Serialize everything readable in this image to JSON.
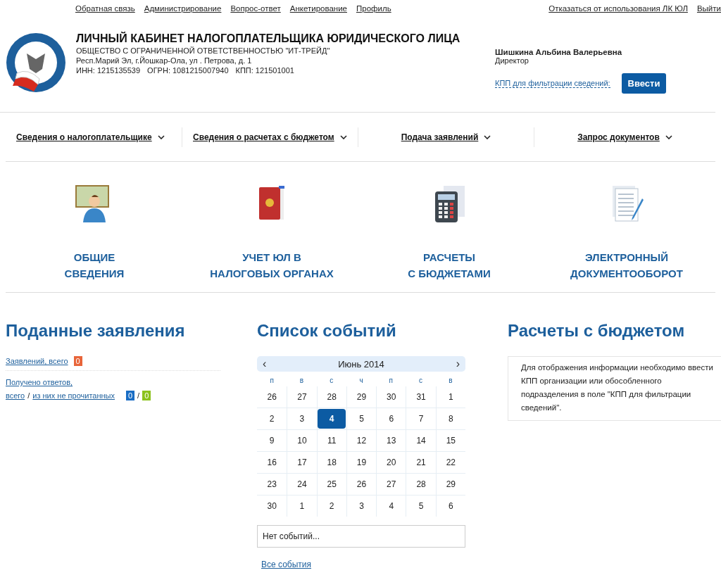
{
  "top_links": [
    "Обратная связь",
    "Администрирование",
    "Вопрос-ответ",
    "Анкетирование",
    "Профиль"
  ],
  "top_right_links": [
    "Отказаться от использования ЛК ЮЛ",
    "Выйти"
  ],
  "header": {
    "title": "ЛИЧНЫЙ КАБИНЕТ НАЛОГОПЛАТЕЛЬЩИКА ЮРИДИЧЕСКОГО ЛИЦА",
    "company": "ОБЩЕСТВО С ОГРАНИЧЕННОЙ ОТВЕТСТВЕННОСТЬЮ \"ИТ-ТРЕЙД\"",
    "address": "Респ.Марий Эл, г.Йошкар-Ола, ул . Петрова, д. 1",
    "ids": [
      "ИНН: 1215135539",
      "ОГРН: 1081215007940",
      "КПП: 121501001"
    ]
  },
  "user": {
    "name": "Шишкина Альбина Валерьевна",
    "role": "Директор",
    "kpp_link": "КПП для фильтрации сведений:",
    "kpp_button": "Ввести"
  },
  "nav": [
    "Сведения о налогоплательщике",
    "Сведения о расчетах с бюджетом",
    "Подача заявлений",
    "Запрос документов"
  ],
  "sections": [
    {
      "kind": "person",
      "title": [
        "ОБЩИЕ",
        "СВЕДЕНИЯ"
      ]
    },
    {
      "kind": "book",
      "title": [
        "УЧЕТ ЮЛ В",
        "НАЛОГОВЫХ ОРГАНАХ"
      ]
    },
    {
      "kind": "calculator",
      "title": [
        "РАСЧЕТЫ",
        "С БЮДЖЕТАМИ"
      ]
    },
    {
      "kind": "document",
      "title": [
        "ЭЛЕКТРОННЫЙ",
        "ДОКУМЕНТООБОРОТ"
      ]
    }
  ],
  "applications": {
    "title": "Поданные заявления",
    "total_label": "Заявлений, всего",
    "total_count": {
      "text": "0",
      "color": "#e8653a"
    },
    "answers_label": "Получено ответов,",
    "answers_total": "всего",
    "answers_unread": "из них не прочитанных",
    "slash": "/",
    "answer_counts": [
      {
        "text": "0",
        "color": "#1a6dc4"
      },
      {
        "text": "0",
        "color": "#8cc21e"
      }
    ]
  },
  "events": {
    "title": "Список событий",
    "month": "Июнь 2014",
    "prev": "‹",
    "next": "›",
    "weekdays": [
      "п",
      "в",
      "с",
      "ч",
      "п",
      "с",
      "в"
    ],
    "weeks": [
      [
        {
          "label": "26",
          "selected": false
        },
        {
          "label": "27",
          "selected": false
        },
        {
          "label": "28",
          "selected": false
        },
        {
          "label": "29",
          "selected": false
        },
        {
          "label": "30",
          "selected": false
        },
        {
          "label": "31",
          "selected": false
        },
        {
          "label": "1",
          "selected": false
        }
      ],
      [
        {
          "label": "2",
          "selected": false
        },
        {
          "label": "3",
          "selected": false
        },
        {
          "label": "4",
          "selected": true
        },
        {
          "label": "5",
          "selected": false
        },
        {
          "label": "6",
          "selected": false
        },
        {
          "label": "7",
          "selected": false
        },
        {
          "label": "8",
          "selected": false
        }
      ],
      [
        {
          "label": "9",
          "selected": false
        },
        {
          "label": "10",
          "selected": false
        },
        {
          "label": "11",
          "selected": false
        },
        {
          "label": "12",
          "selected": false
        },
        {
          "label": "13",
          "selected": false
        },
        {
          "label": "14",
          "selected": false
        },
        {
          "label": "15",
          "selected": false
        }
      ],
      [
        {
          "label": "16",
          "selected": false
        },
        {
          "label": "17",
          "selected": false
        },
        {
          "label": "18",
          "selected": false
        },
        {
          "label": "19",
          "selected": false
        },
        {
          "label": "20",
          "selected": false
        },
        {
          "label": "21",
          "selected": false
        },
        {
          "label": "22",
          "selected": false
        }
      ],
      [
        {
          "label": "23",
          "selected": false
        },
        {
          "label": "24",
          "selected": false
        },
        {
          "label": "25",
          "selected": false
        },
        {
          "label": "26",
          "selected": false
        },
        {
          "label": "27",
          "selected": false
        },
        {
          "label": "28",
          "selected": false
        },
        {
          "label": "29",
          "selected": false
        }
      ],
      [
        {
          "label": "30",
          "selected": false
        },
        {
          "label": "1",
          "selected": false
        },
        {
          "label": "2",
          "selected": false
        },
        {
          "label": "3",
          "selected": false
        },
        {
          "label": "4",
          "selected": false
        },
        {
          "label": "5",
          "selected": false
        },
        {
          "label": "6",
          "selected": false
        }
      ]
    ],
    "no_events": "Нет событий...",
    "all_link": "Все события"
  },
  "budget": {
    "title": "Расчеты с бюджетом",
    "message": "Для отображения информации необходимо ввести КПП организации или обособленного подразделения в поле \"КПП для фильтрации сведений\"."
  }
}
